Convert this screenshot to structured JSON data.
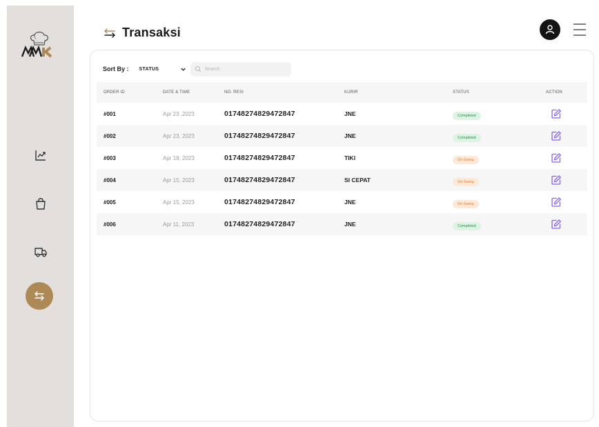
{
  "brand": {
    "logo_text": "MK"
  },
  "header": {
    "title": "Transaksi"
  },
  "sort": {
    "label": "Sort By :",
    "selected": "STATUS",
    "search_placeholder": "Search"
  },
  "table": {
    "columns": [
      "ORDER ID",
      "DATE & TIME",
      "NO. RESI",
      "KURIR",
      "STATUS",
      "ACTION"
    ],
    "rows": [
      {
        "order_id": "#001",
        "date": "Apr 23 ,2023",
        "resi": "01748274829472847",
        "kurir": "JNE",
        "status": "Completed",
        "status_type": "completed"
      },
      {
        "order_id": "#002",
        "date": "Apr 23, 2023",
        "resi": "01748274829472847",
        "kurir": "JNE",
        "status": "Completed",
        "status_type": "completed"
      },
      {
        "order_id": "#003",
        "date": "Apr 18, 2023",
        "resi": "01748274829472847",
        "kurir": "TIKI",
        "status": "On Going",
        "status_type": "ongoing"
      },
      {
        "order_id": "#004",
        "date": "Apr 15, 2023",
        "resi": "01748274829472847",
        "kurir": "SI CEPAT",
        "status": "On Going",
        "status_type": "ongoing"
      },
      {
        "order_id": "#005",
        "date": "Apr 15, 2023",
        "resi": "01748274829472847",
        "kurir": "JNE",
        "status": "On Going",
        "status_type": "ongoing"
      },
      {
        "order_id": "#006",
        "date": "Apr 11, 2023",
        "resi": "01748274829472847",
        "kurir": "JNE",
        "status": "Completed",
        "status_type": "completed"
      }
    ]
  },
  "sidebar": {
    "items": [
      {
        "icon": "chart-trend-icon"
      },
      {
        "icon": "shopping-bag-icon"
      },
      {
        "icon": "delivery-truck-icon"
      },
      {
        "icon": "transfer-arrows-icon",
        "active": true
      }
    ]
  },
  "colors": {
    "accent": "#ad8a55",
    "sidebar_bg": "#e3dfdc",
    "edit_icon": "#8b5cf6",
    "completed": "#2f8a4c",
    "ongoing": "#e07a2f"
  }
}
